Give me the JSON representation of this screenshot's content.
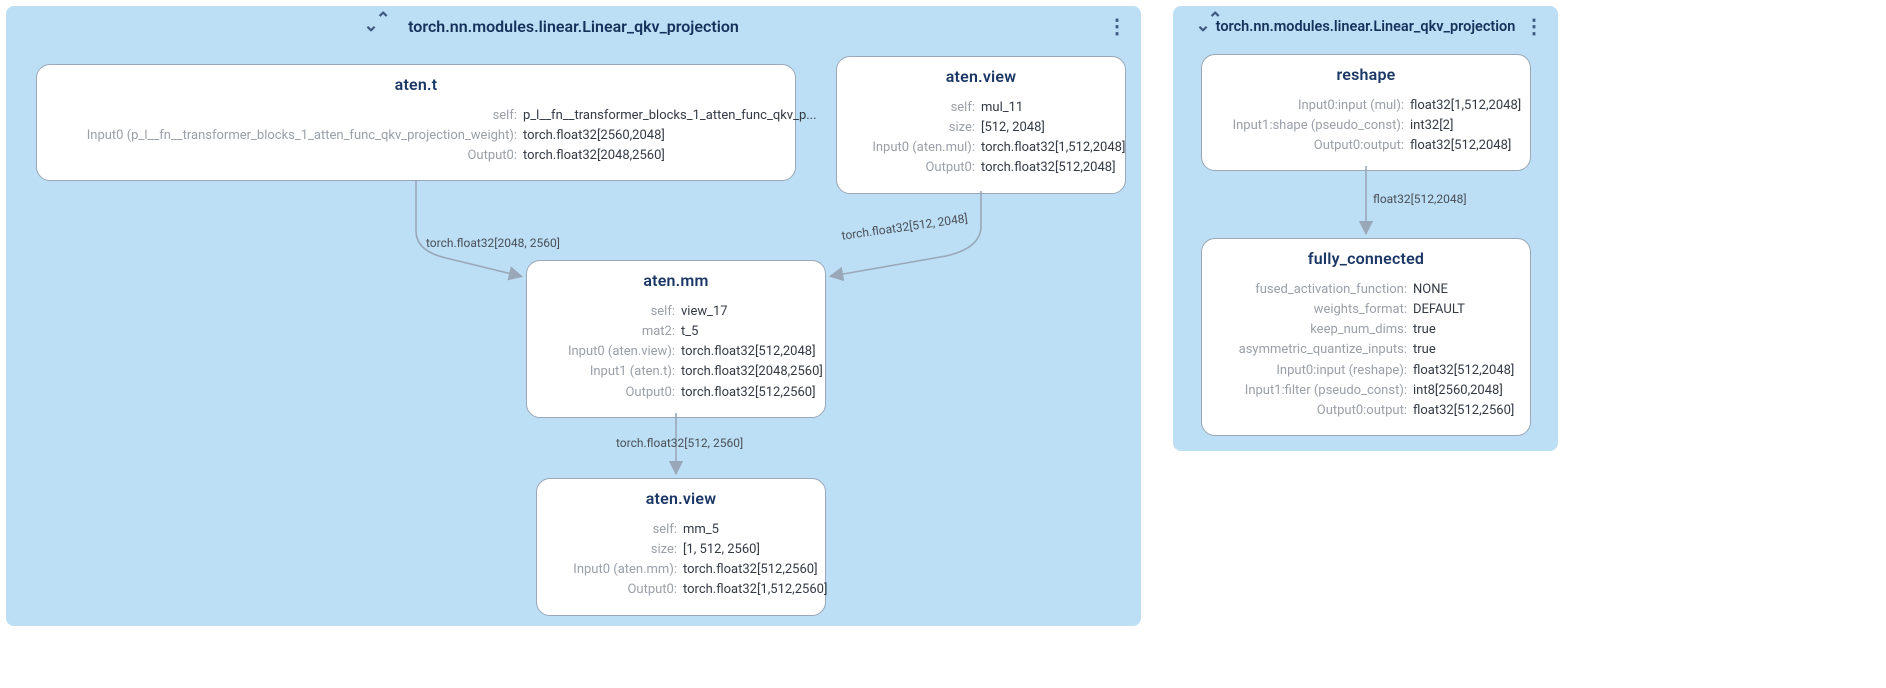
{
  "left": {
    "title": "torch.nn.modules.linear.Linear_qkv_projection",
    "nodes": {
      "aten_t": {
        "title": "aten.t",
        "rows": [
          {
            "k": "self:",
            "v": "p_l__fn__transformer_blocks_1_atten_func_qkv_p..."
          },
          {
            "k": "Input0 (p_l__fn__transformer_blocks_1_atten_func_qkv_projection_weight):",
            "v": "torch.float32[2560,2048]"
          },
          {
            "k": "Output0:",
            "v": "torch.float32[2048,2560]"
          }
        ]
      },
      "aten_view_top": {
        "title": "aten.view",
        "rows": [
          {
            "k": "self:",
            "v": "mul_11"
          },
          {
            "k": "size:",
            "v": "[512, 2048]"
          },
          {
            "k": "Input0 (aten.mul):",
            "v": "torch.float32[1,512,2048]"
          },
          {
            "k": "Output0:",
            "v": "torch.float32[512,2048]"
          }
        ]
      },
      "aten_mm": {
        "title": "aten.mm",
        "rows": [
          {
            "k": "self:",
            "v": "view_17"
          },
          {
            "k": "mat2:",
            "v": "t_5"
          },
          {
            "k": "Input0 (aten.view):",
            "v": "torch.float32[512,2048]"
          },
          {
            "k": "Input1 (aten.t):",
            "v": "torch.float32[2048,2560]"
          },
          {
            "k": "Output0:",
            "v": "torch.float32[512,2560]"
          }
        ]
      },
      "aten_view_bottom": {
        "title": "aten.view",
        "rows": [
          {
            "k": "self:",
            "v": "mm_5"
          },
          {
            "k": "size:",
            "v": "[1, 512, 2560]"
          },
          {
            "k": "Input0 (aten.mm):",
            "v": "torch.float32[512,2560]"
          },
          {
            "k": "Output0:",
            "v": "torch.float32[1,512,2560]"
          }
        ]
      }
    },
    "edges": {
      "t_to_mm": "torch.float32[2048, 2560]",
      "view_to_mm": "torch.float32[512, 2048]",
      "mm_to_view": "torch.float32[512, 2560]"
    }
  },
  "right": {
    "title": "torch.nn.modules.linear.Linear_qkv_projection",
    "nodes": {
      "reshape": {
        "title": "reshape",
        "rows": [
          {
            "k": "Input0:input (mul):",
            "v": "float32[1,512,2048]"
          },
          {
            "k": "Input1:shape (pseudo_const):",
            "v": "int32[2]"
          },
          {
            "k": "Output0:output:",
            "v": "float32[512,2048]"
          }
        ]
      },
      "fully_connected": {
        "title": "fully_connected",
        "rows": [
          {
            "k": "fused_activation_function:",
            "v": "NONE"
          },
          {
            "k": "weights_format:",
            "v": "DEFAULT"
          },
          {
            "k": "keep_num_dims:",
            "v": "true"
          },
          {
            "k": "asymmetric_quantize_inputs:",
            "v": "true"
          },
          {
            "k": "Input0:input (reshape):",
            "v": "float32[512,2048]"
          },
          {
            "k": "Input1:filter (pseudo_const):",
            "v": "int8[2560,2048]"
          },
          {
            "k": "Output0:output:",
            "v": "float32[512,2560]"
          }
        ]
      }
    },
    "edges": {
      "reshape_to_fc": "float32[512,2048]"
    }
  }
}
